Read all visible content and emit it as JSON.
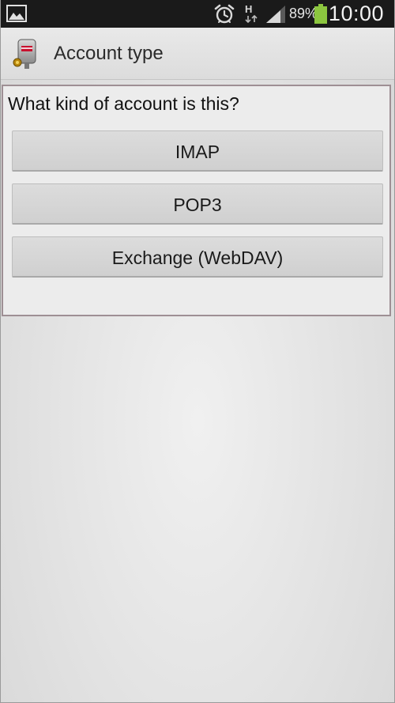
{
  "status_bar": {
    "left_icon": "gallery-icon",
    "alarm_icon": "alarm-clock-icon",
    "network_type": "H",
    "signal_icon": "signal-strength-icon",
    "battery_percent": "89%",
    "battery_level": 0.89,
    "battery_color": "#8cc63f",
    "clock": "10:00"
  },
  "header": {
    "app_icon": "mail-app-icon",
    "title": "Account type"
  },
  "dialog": {
    "question": "What kind of account is this?",
    "options": [
      {
        "label": "IMAP"
      },
      {
        "label": "POP3"
      },
      {
        "label": "Exchange (WebDAV)"
      }
    ]
  }
}
